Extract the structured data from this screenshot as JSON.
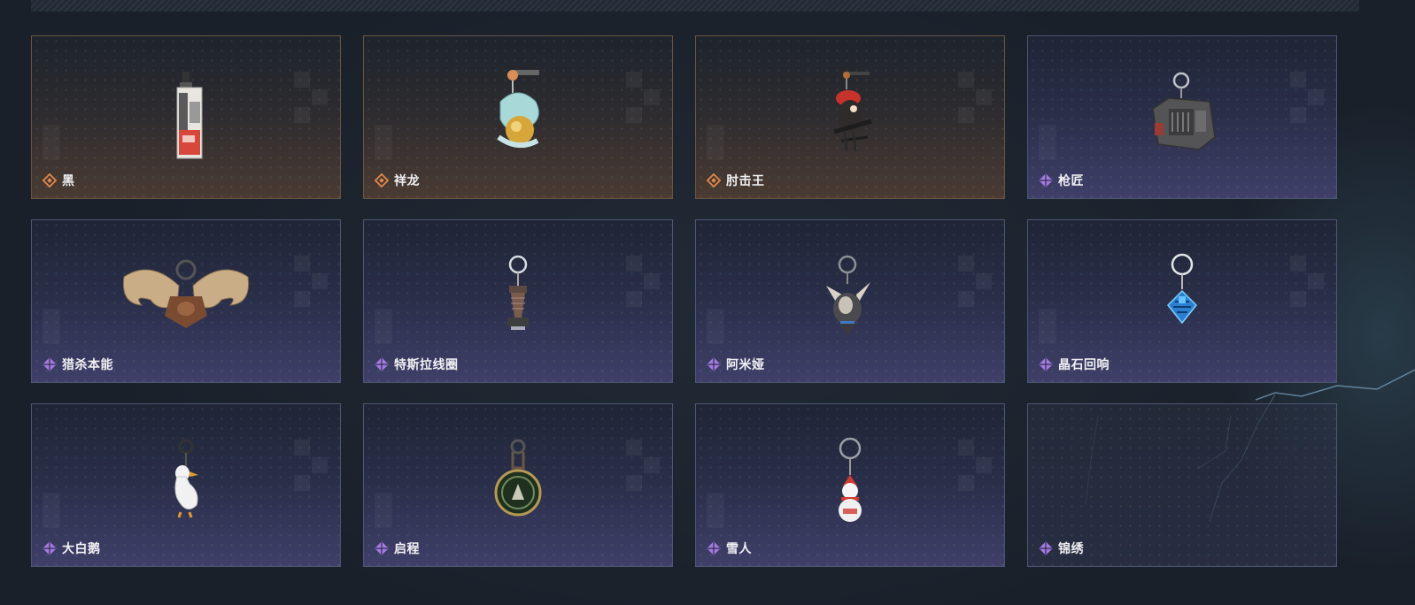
{
  "colors": {
    "orange_rarity": "#e0874a",
    "purple_rarity": "#a57be0",
    "card_border": "#4d5773"
  },
  "items": [
    {
      "name": "黑",
      "rarity": "orange",
      "icon": "paper-tag-charm-icon"
    },
    {
      "name": "祥龙",
      "rarity": "orange",
      "icon": "dragon-charm-icon"
    },
    {
      "name": "肘击王",
      "rarity": "orange",
      "icon": "bird-soldier-charm-icon"
    },
    {
      "name": "枪匠",
      "rarity": "purple",
      "icon": "gun-case-charm-icon"
    },
    {
      "name": "猎杀本能",
      "rarity": "purple",
      "icon": "moose-antler-charm-icon"
    },
    {
      "name": "特斯拉线圈",
      "rarity": "purple",
      "icon": "tesla-coil-charm-icon"
    },
    {
      "name": "阿米娅",
      "rarity": "purple",
      "icon": "bunny-charm-icon"
    },
    {
      "name": "晶石回响",
      "rarity": "purple",
      "icon": "crystal-charm-icon"
    },
    {
      "name": "大白鹅",
      "rarity": "purple",
      "icon": "white-goose-charm-icon"
    },
    {
      "name": "启程",
      "rarity": "purple",
      "icon": "medal-charm-icon"
    },
    {
      "name": "雪人",
      "rarity": "purple",
      "icon": "snowman-charm-icon"
    },
    {
      "name": "锦绣",
      "rarity": "purple",
      "icon": ""
    }
  ]
}
